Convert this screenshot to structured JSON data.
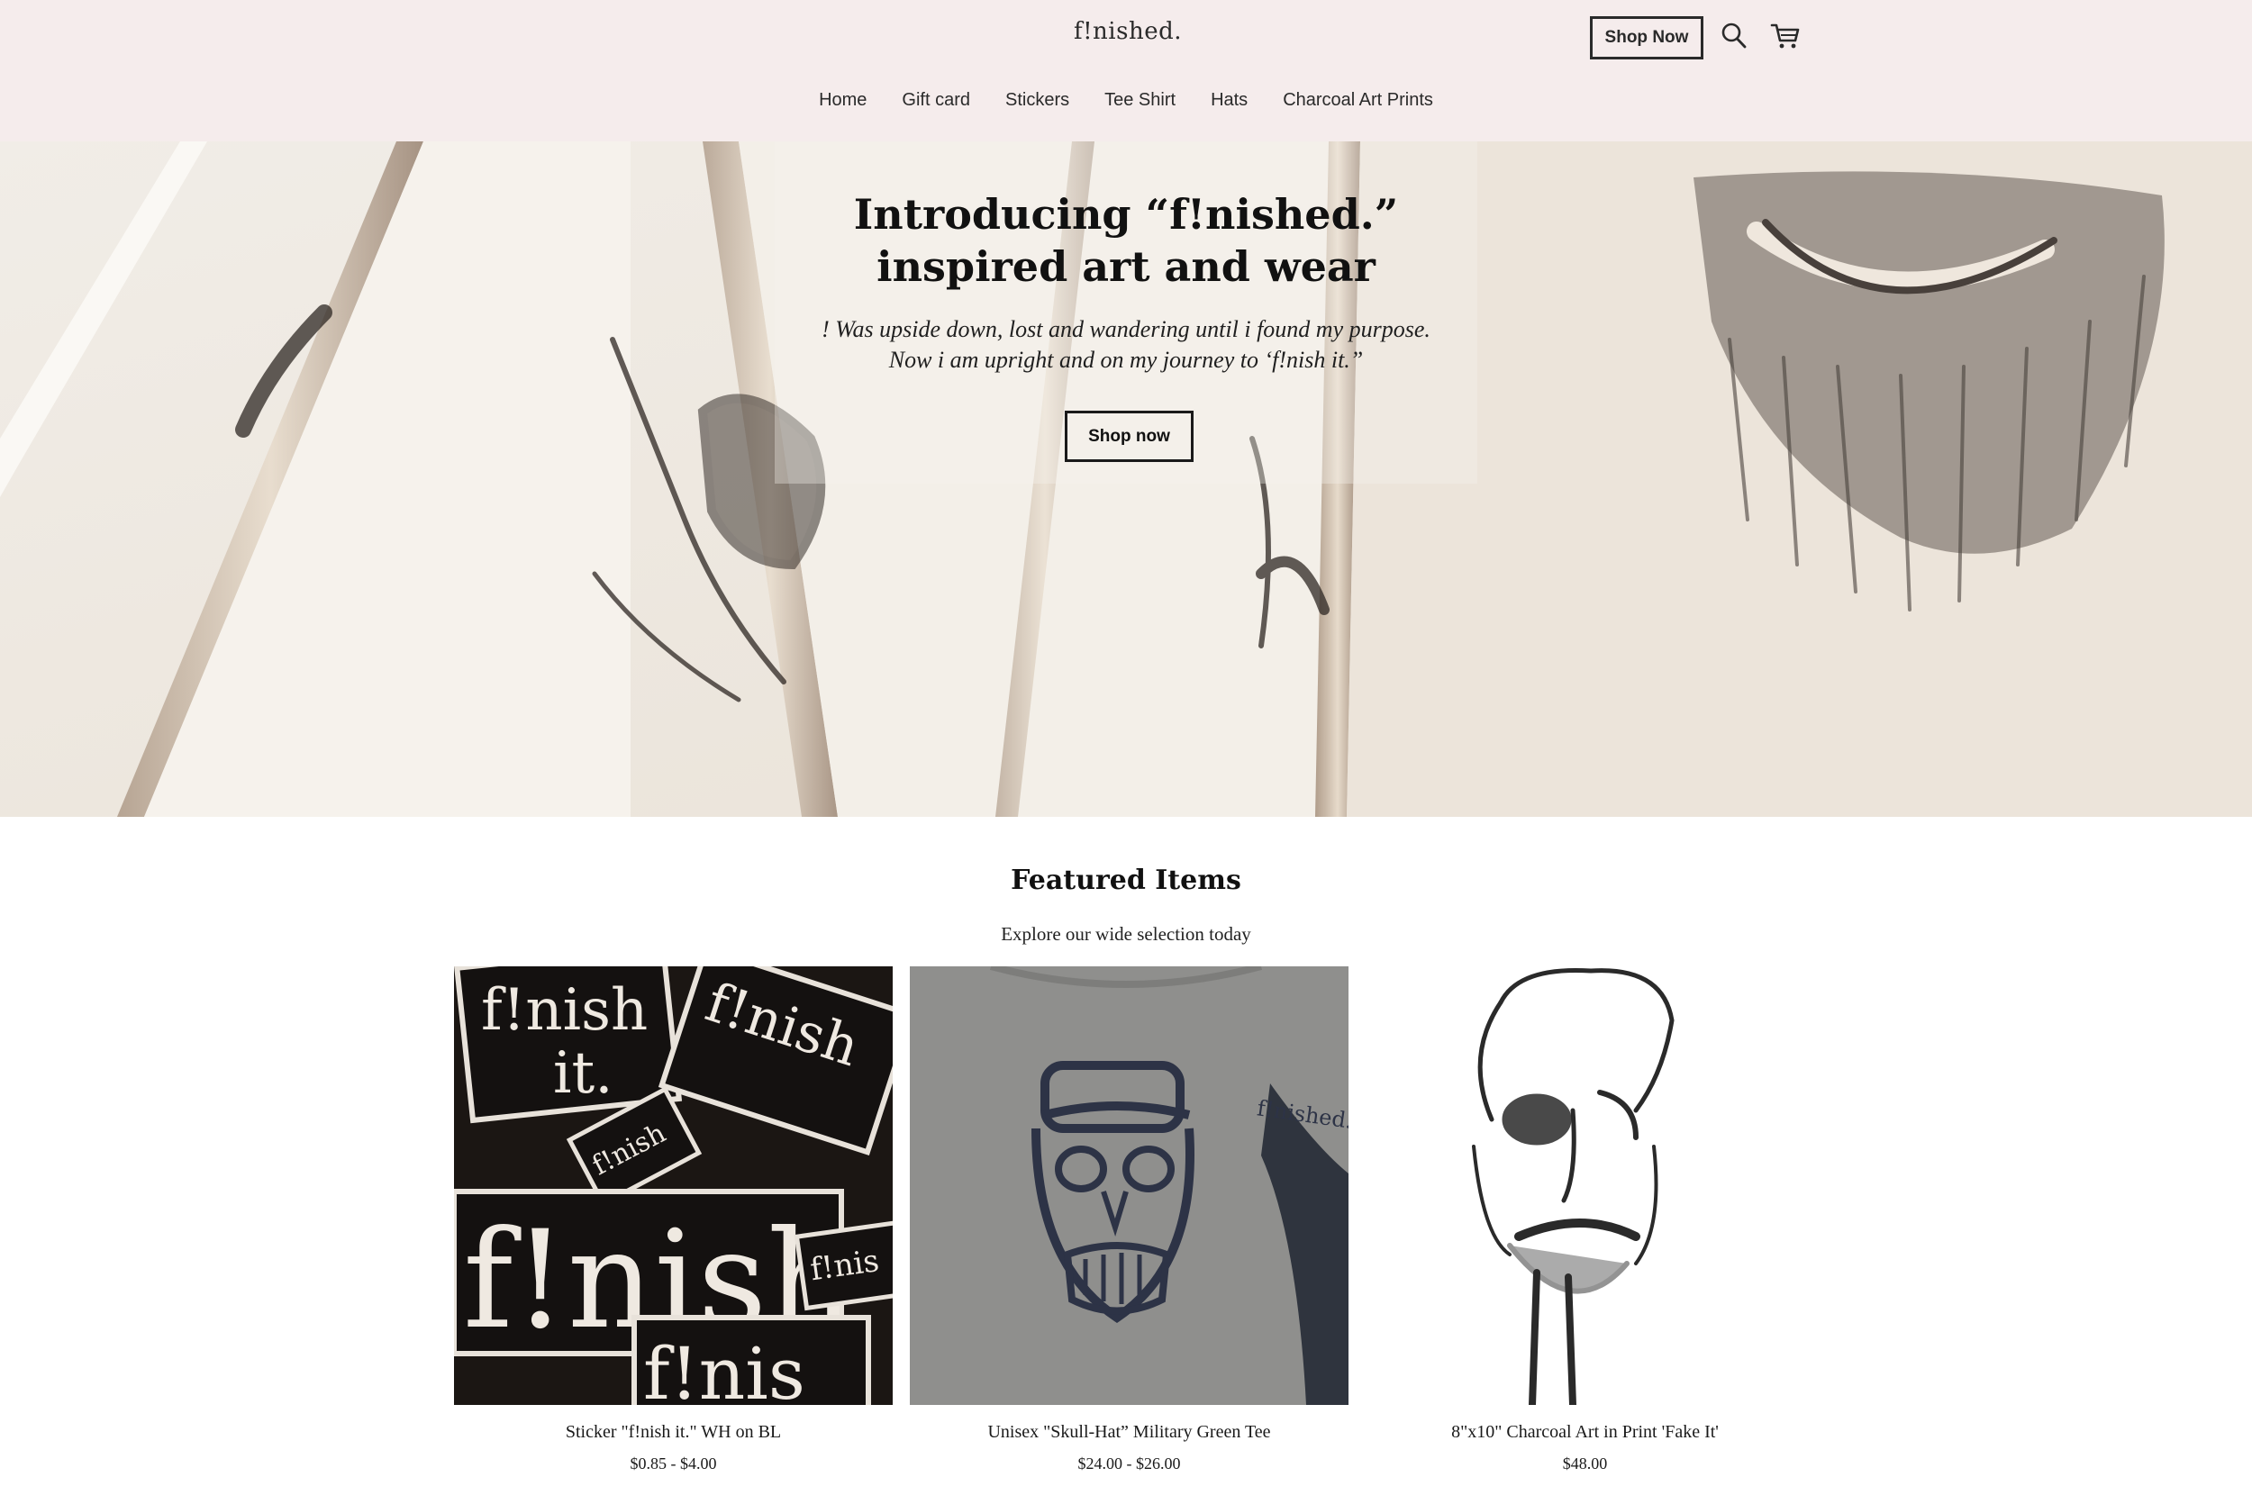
{
  "header": {
    "logo": "f!nished.",
    "shop_now_label": "Shop Now",
    "icons": [
      "search-icon",
      "cart-icon"
    ],
    "background": "#f5ecec"
  },
  "nav": {
    "items": [
      {
        "label": "Home"
      },
      {
        "label": "Gift card"
      },
      {
        "label": "Stickers"
      },
      {
        "label": "Tee Shirt"
      },
      {
        "label": "Hats"
      },
      {
        "label": "Charcoal Art Prints"
      }
    ]
  },
  "hero": {
    "title_line1": "Introducing “f!nished.”",
    "title_line2": "inspired art and wear",
    "sub_line1": "! Was upside down, lost and wandering until i found my purpose.",
    "sub_line2": "Now i am upright and on my journey to ‘f!nish it.”",
    "button_label": "Shop now"
  },
  "featured": {
    "title": "Featured Items",
    "subtitle": "Explore our wide selection today",
    "products": [
      {
        "name": "Sticker \"f!nish it.\" WH on BL",
        "price": "$0.85 - $4.00"
      },
      {
        "name": "Unisex \"Skull-Hat” Military Green Tee",
        "price": "$24.00 - $26.00"
      },
      {
        "name": "8\"x10\" Charcoal Art in Print 'Fake It'",
        "price": "$48.00"
      }
    ]
  }
}
